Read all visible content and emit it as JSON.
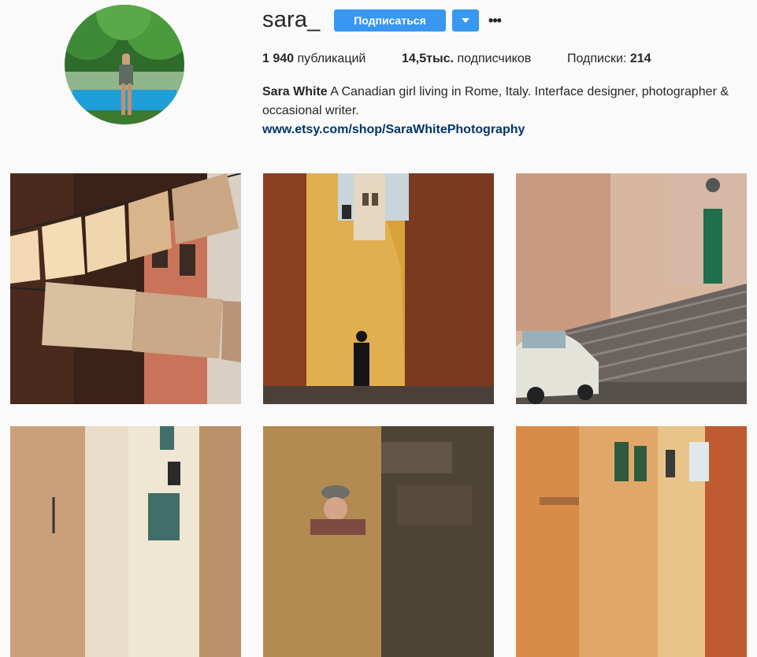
{
  "profile": {
    "username": "sara_",
    "follow_label": "Подписаться",
    "dropdown_icon": "caret-down-icon",
    "more_icon": "ellipsis-icon",
    "more_label": "•••"
  },
  "stats": {
    "posts_count": "1 940",
    "posts_label": "публикаций",
    "followers_count": "14,5тыс.",
    "followers_label": "подписчиков",
    "following_label": "Подписки:",
    "following_count": "214"
  },
  "bio": {
    "name": "Sara White",
    "text": " A Canadian girl living in Rome, Italy. Interface designer, photographer & occasional writer.",
    "link": "www.etsy.com/shop/SaraWhitePhotography"
  },
  "colors": {
    "accent": "#3897f0",
    "link": "#003569",
    "background": "#fafafa"
  },
  "posts": [
    {
      "subject": "laundry-hanging-street-photo"
    },
    {
      "subject": "yellow-alley-bell-tower-photo"
    },
    {
      "subject": "fiat-500-stairs-photo"
    },
    {
      "subject": "lamp-alley-photo"
    },
    {
      "subject": "old-man-wall-photo"
    },
    {
      "subject": "orange-buildings-street-photo"
    }
  ]
}
